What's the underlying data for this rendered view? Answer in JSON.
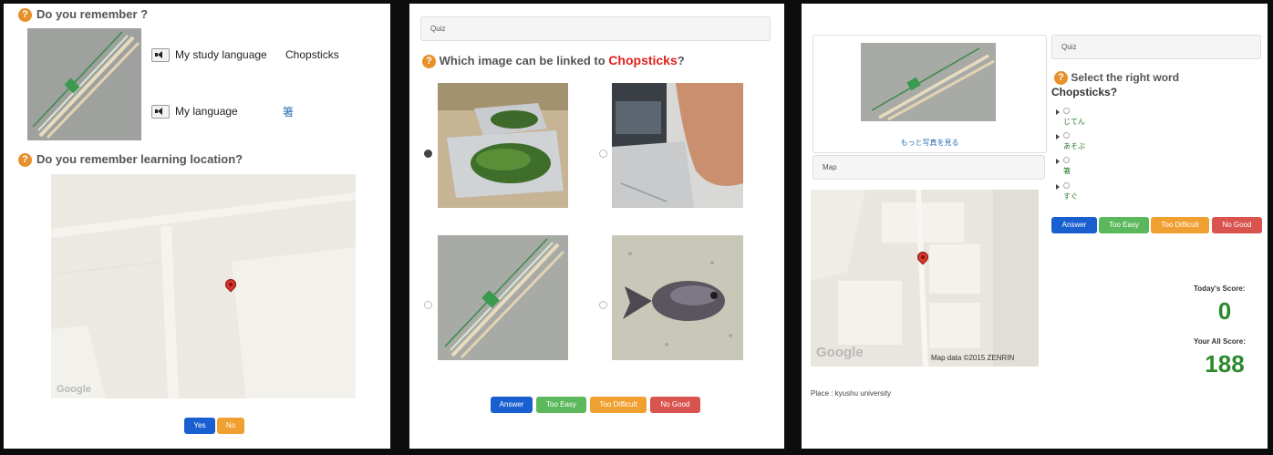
{
  "panel1": {
    "remember_heading": "Do you remember ?",
    "study_language_label": "My study language",
    "study_language_value": "Chopsticks",
    "my_language_label": "My language",
    "my_language_value": "箸",
    "location_heading": "Do you remember learning location?",
    "map_logo": "Google",
    "buttons": {
      "yes": "Yes",
      "no": "No"
    }
  },
  "panel2": {
    "quiz_bar": "Quiz",
    "question_prefix": "Which image can be linked to",
    "question_word": "Chopsticks",
    "question_suffix": "?",
    "selected_option": 1,
    "buttons": {
      "answer": "Answer",
      "too_easy": "Too Easy",
      "too_difficult": "Too Difficult",
      "no_good": "No Good"
    }
  },
  "panel3": {
    "more_photos_link": "もっと写真を見る",
    "map_bar": "Map",
    "map_logo": "Google",
    "map_attribution": "Map data ©2015 ZENRIN",
    "place_text": "Place : kyushu university",
    "quiz_bar": "Quiz",
    "question": "Select the right word",
    "question_word": "Chopsticks",
    "question_suffix": "?",
    "choices": [
      "じてん",
      "あそぶ",
      "箸",
      "すぐ"
    ],
    "buttons": {
      "answer": "Answer",
      "too_easy": "Too Easy",
      "too_difficult": "Too Difficult",
      "no_good": "No Good"
    },
    "today_score_label": "Today's Score:",
    "today_score": "0",
    "all_score_label": "Your All Score:",
    "all_score": "188"
  },
  "colors": {
    "question_icon": "#e8902a",
    "highlight_word": "#e02020",
    "score": "#2b8a2b",
    "answer": "#1a5fcf",
    "too_easy": "#5cb85c",
    "too_difficult": "#f0a030",
    "no_good": "#d9534f"
  }
}
